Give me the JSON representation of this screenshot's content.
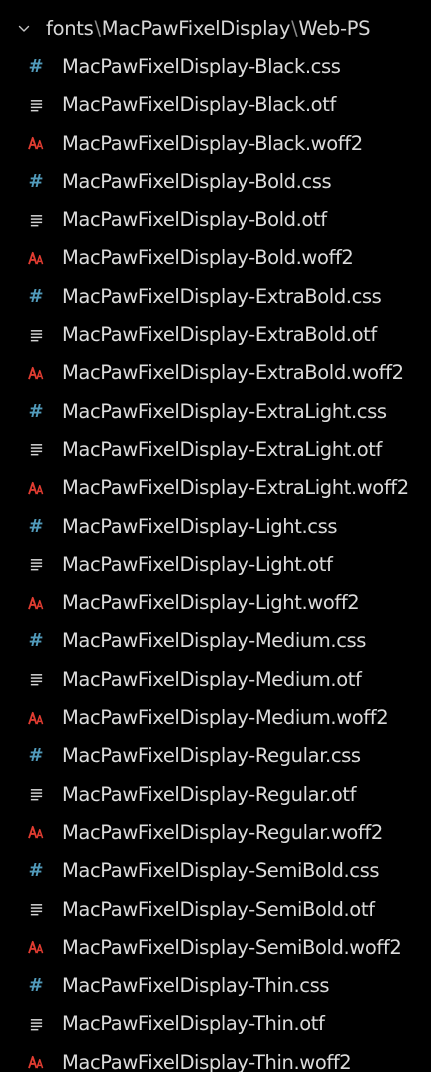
{
  "explorer": {
    "folder": {
      "segments": [
        "fonts",
        "MacPawFixelDisplay",
        "Web-PS"
      ],
      "separator": "\\"
    },
    "colors": {
      "background": "#000000",
      "text": "#dcdcdc",
      "css_icon": "#519aba",
      "otf_icon": "#d4d4d4",
      "woff2_icon": "#e03c31"
    },
    "files": [
      {
        "name": "MacPawFixelDisplay-Black.css",
        "icon": "css-hash-icon"
      },
      {
        "name": "MacPawFixelDisplay-Black.otf",
        "icon": "text-lines-icon"
      },
      {
        "name": "MacPawFixelDisplay-Black.woff2",
        "icon": "font-icon"
      },
      {
        "name": "MacPawFixelDisplay-Bold.css",
        "icon": "css-hash-icon"
      },
      {
        "name": "MacPawFixelDisplay-Bold.otf",
        "icon": "text-lines-icon"
      },
      {
        "name": "MacPawFixelDisplay-Bold.woff2",
        "icon": "font-icon"
      },
      {
        "name": "MacPawFixelDisplay-ExtraBold.css",
        "icon": "css-hash-icon"
      },
      {
        "name": "MacPawFixelDisplay-ExtraBold.otf",
        "icon": "text-lines-icon"
      },
      {
        "name": "MacPawFixelDisplay-ExtraBold.woff2",
        "icon": "font-icon"
      },
      {
        "name": "MacPawFixelDisplay-ExtraLight.css",
        "icon": "css-hash-icon"
      },
      {
        "name": "MacPawFixelDisplay-ExtraLight.otf",
        "icon": "text-lines-icon"
      },
      {
        "name": "MacPawFixelDisplay-ExtraLight.woff2",
        "icon": "font-icon"
      },
      {
        "name": "MacPawFixelDisplay-Light.css",
        "icon": "css-hash-icon"
      },
      {
        "name": "MacPawFixelDisplay-Light.otf",
        "icon": "text-lines-icon"
      },
      {
        "name": "MacPawFixelDisplay-Light.woff2",
        "icon": "font-icon"
      },
      {
        "name": "MacPawFixelDisplay-Medium.css",
        "icon": "css-hash-icon"
      },
      {
        "name": "MacPawFixelDisplay-Medium.otf",
        "icon": "text-lines-icon"
      },
      {
        "name": "MacPawFixelDisplay-Medium.woff2",
        "icon": "font-icon"
      },
      {
        "name": "MacPawFixelDisplay-Regular.css",
        "icon": "css-hash-icon"
      },
      {
        "name": "MacPawFixelDisplay-Regular.otf",
        "icon": "text-lines-icon"
      },
      {
        "name": "MacPawFixelDisplay-Regular.woff2",
        "icon": "font-icon"
      },
      {
        "name": "MacPawFixelDisplay-SemiBold.css",
        "icon": "css-hash-icon"
      },
      {
        "name": "MacPawFixelDisplay-SemiBold.otf",
        "icon": "text-lines-icon"
      },
      {
        "name": "MacPawFixelDisplay-SemiBold.woff2",
        "icon": "font-icon"
      },
      {
        "name": "MacPawFixelDisplay-Thin.css",
        "icon": "css-hash-icon"
      },
      {
        "name": "MacPawFixelDisplay-Thin.otf",
        "icon": "text-lines-icon"
      },
      {
        "name": "MacPawFixelDisplay-Thin.woff2",
        "icon": "font-icon"
      }
    ]
  }
}
